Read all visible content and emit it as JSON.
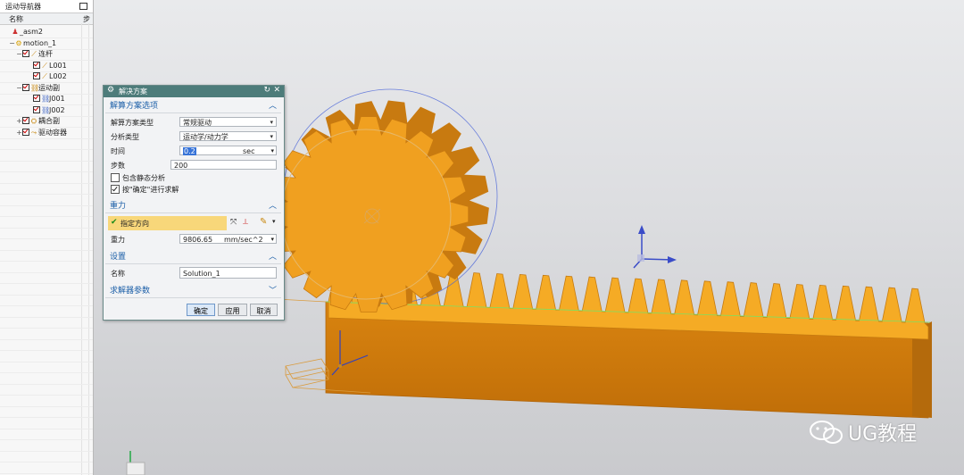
{
  "navigator": {
    "title": "运动导航器",
    "col_name": "名称",
    "col_2": "步",
    "tree": [
      {
        "label": "_asm2",
        "icon": "assembly-icon",
        "expander": ""
      },
      {
        "label": "motion_1",
        "icon": "motion-icon",
        "expander": "−"
      },
      {
        "label": "连杆",
        "icon": "links-icon",
        "expander": "−"
      },
      {
        "label": "L001",
        "icon": "link-icon",
        "expander": ""
      },
      {
        "label": "L002",
        "icon": "link-icon",
        "expander": ""
      },
      {
        "label": "运动副",
        "icon": "joints-icon",
        "expander": "−"
      },
      {
        "label": "J001",
        "icon": "joint-icon",
        "expander": ""
      },
      {
        "label": "J002",
        "icon": "joint-icon",
        "expander": ""
      },
      {
        "label": "耦合副",
        "icon": "coupler-icon",
        "expander": "+"
      },
      {
        "label": "驱动容器",
        "icon": "driver-icon",
        "expander": "+"
      }
    ]
  },
  "dialog": {
    "title": "解决方案",
    "sections": {
      "solution_options": "解算方案选项",
      "gravity": "重力",
      "settings": "设置",
      "solver_params": "求解器参数"
    },
    "solution_type_label": "解算方案类型",
    "solution_type_value": "常规驱动",
    "analysis_type_label": "分析类型",
    "analysis_type_value": "运动学/动力学",
    "time_label": "时间",
    "time_value": "0.2",
    "time_unit": "sec",
    "steps_label": "步数",
    "steps_value": "200",
    "static_label": "包含静态分析",
    "static_checked": false,
    "press_ok_label": "按\"确定\"进行求解",
    "press_ok_checked": true,
    "direction_label": "指定方向",
    "gravity_label": "重力",
    "gravity_value": "9806.65",
    "gravity_unit": "mm/sec^2",
    "name_label": "名称",
    "name_value": "Solution_1",
    "ok": "确定",
    "apply": "应用",
    "cancel": "取消"
  },
  "watermark": "UG教程",
  "colors": {
    "gear": "#f0a020",
    "gear_dark": "#c87a10",
    "dialog_title": "#4d7c7a",
    "section_text": "#1c5fa8",
    "direction_highlight": "#f8d77a"
  }
}
